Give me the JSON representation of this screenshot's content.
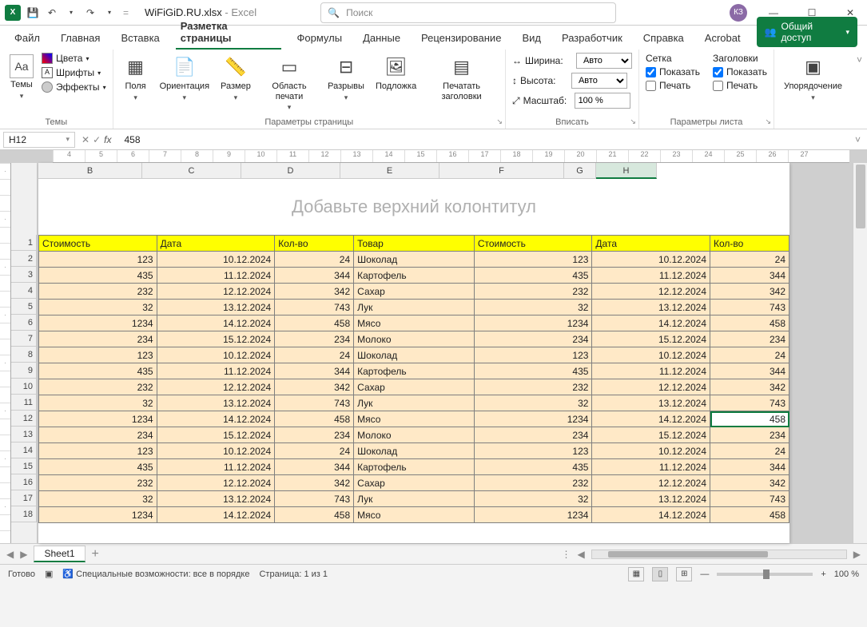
{
  "title": {
    "filename": "WiFiGiD.RU.xlsx",
    "app": "Excel"
  },
  "search_placeholder": "Поиск",
  "user_initials": "КЗ",
  "tabs": [
    "Файл",
    "Главная",
    "Вставка",
    "Разметка страницы",
    "Формулы",
    "Данные",
    "Рецензирование",
    "Вид",
    "Разработчик",
    "Справка",
    "Acrobat"
  ],
  "active_tab_index": 3,
  "share_label": "Общий доступ",
  "ribbon": {
    "themes": {
      "themes": "Темы",
      "colors": "Цвета",
      "fonts": "Шрифты",
      "effects": "Эффекты",
      "group": "Темы"
    },
    "pagesetup": {
      "margins": "Поля",
      "orientation": "Ориентация",
      "size": "Размер",
      "printarea": "Область печати",
      "breaks": "Разрывы",
      "background": "Подложка",
      "printtitles": "Печатать заголовки",
      "group": "Параметры страницы"
    },
    "fit": {
      "width": "Ширина:",
      "height": "Высота:",
      "scale": "Масштаб:",
      "auto": "Авто",
      "scale_val": "100 %",
      "group": "Вписать"
    },
    "sheetopts": {
      "grid": "Сетка",
      "headings": "Заголовки",
      "show": "Показать",
      "print": "Печать",
      "group": "Параметры листа"
    },
    "arrange": {
      "arrange": "Упорядочение"
    }
  },
  "namebox": "H12",
  "formula": "458",
  "colheaders": [
    "B",
    "C",
    "D",
    "E",
    "F",
    "G",
    "H"
  ],
  "header_placeholder": "Добавьте верхний колонтитул",
  "table_headers": [
    "Стоимость",
    "Дата",
    "Кол-во",
    "Товар",
    "Стоимость",
    "Дата",
    "Кол-во"
  ],
  "rows": [
    {
      "n": 2,
      "c": [
        "123",
        "10.12.2024",
        "24",
        "Шоколад",
        "123",
        "10.12.2024",
        "24"
      ]
    },
    {
      "n": 3,
      "c": [
        "435",
        "11.12.2024",
        "344",
        "Картофель",
        "435",
        "11.12.2024",
        "344"
      ]
    },
    {
      "n": 4,
      "c": [
        "232",
        "12.12.2024",
        "342",
        "Сахар",
        "232",
        "12.12.2024",
        "342"
      ]
    },
    {
      "n": 5,
      "c": [
        "32",
        "13.12.2024",
        "743",
        "Лук",
        "32",
        "13.12.2024",
        "743"
      ]
    },
    {
      "n": 6,
      "c": [
        "1234",
        "14.12.2024",
        "458",
        "Мясо",
        "1234",
        "14.12.2024",
        "458"
      ]
    },
    {
      "n": 7,
      "c": [
        "234",
        "15.12.2024",
        "234",
        "Молоко",
        "234",
        "15.12.2024",
        "234"
      ]
    },
    {
      "n": 8,
      "c": [
        "123",
        "10.12.2024",
        "24",
        "Шоколад",
        "123",
        "10.12.2024",
        "24"
      ]
    },
    {
      "n": 9,
      "c": [
        "435",
        "11.12.2024",
        "344",
        "Картофель",
        "435",
        "11.12.2024",
        "344"
      ]
    },
    {
      "n": 10,
      "c": [
        "232",
        "12.12.2024",
        "342",
        "Сахар",
        "232",
        "12.12.2024",
        "342"
      ]
    },
    {
      "n": 11,
      "c": [
        "32",
        "13.12.2024",
        "743",
        "Лук",
        "32",
        "13.12.2024",
        "743"
      ]
    },
    {
      "n": 12,
      "c": [
        "1234",
        "14.12.2024",
        "458",
        "Мясо",
        "1234",
        "14.12.2024",
        "458"
      ]
    },
    {
      "n": 13,
      "c": [
        "234",
        "15.12.2024",
        "234",
        "Молоко",
        "234",
        "15.12.2024",
        "234"
      ]
    },
    {
      "n": 14,
      "c": [
        "123",
        "10.12.2024",
        "24",
        "Шоколад",
        "123",
        "10.12.2024",
        "24"
      ]
    },
    {
      "n": 15,
      "c": [
        "435",
        "11.12.2024",
        "344",
        "Картофель",
        "435",
        "11.12.2024",
        "344"
      ]
    },
    {
      "n": 16,
      "c": [
        "232",
        "12.12.2024",
        "342",
        "Сахар",
        "232",
        "12.12.2024",
        "342"
      ]
    },
    {
      "n": 17,
      "c": [
        "32",
        "13.12.2024",
        "743",
        "Лук",
        "32",
        "13.12.2024",
        "743"
      ]
    },
    {
      "n": 18,
      "c": [
        "1234",
        "14.12.2024",
        "458",
        "Мясо",
        "1234",
        "14.12.2024",
        "458"
      ]
    }
  ],
  "selected_row": 12,
  "ruler_marks": [
    "4",
    "5",
    "6",
    "7",
    "8",
    "9",
    "10",
    "11",
    "12",
    "13",
    "14",
    "15",
    "16",
    "17",
    "18",
    "19",
    "20",
    "21",
    "22",
    "23",
    "24",
    "25",
    "26",
    "27"
  ],
  "sheet_tab": "Sheet1",
  "status": {
    "ready": "Готово",
    "access": "Специальные возможности: все в порядке",
    "page": "Страница: 1 из 1",
    "zoom": "100 %"
  }
}
